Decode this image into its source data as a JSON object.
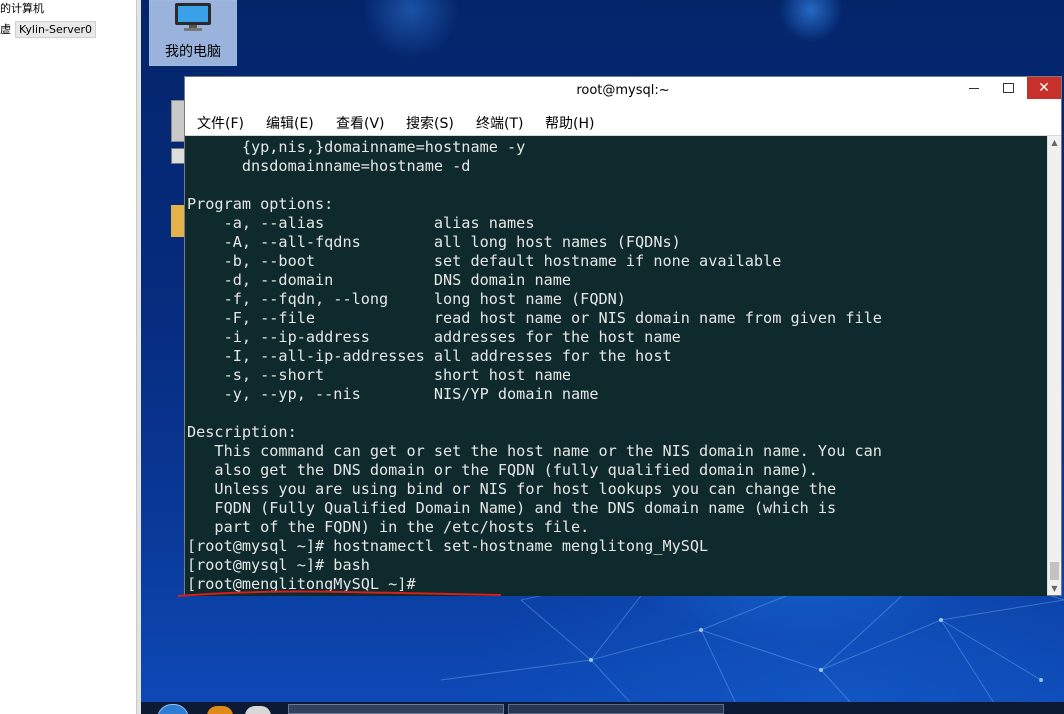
{
  "host_panel": {
    "tree_item_1": "的计算机",
    "tree_prefix": "虚",
    "tree_selected": "Kylin-Server0"
  },
  "desktop": {
    "icon_label": "我的电脑"
  },
  "window": {
    "title": "root@mysql:~",
    "buttons": {
      "minimize_icon": "minimize-icon",
      "maximize_icon": "maximize-icon",
      "close_icon": "close-icon",
      "close_glyph": "✕"
    }
  },
  "menu": [
    {
      "label": "文件(F)"
    },
    {
      "label": "编辑(E)"
    },
    {
      "label": "查看(V)"
    },
    {
      "label": "搜索(S)"
    },
    {
      "label": "终端(T)"
    },
    {
      "label": "帮助(H)"
    }
  ],
  "terminal": {
    "lines": [
      "      {yp,nis,}domainname=hostname -y",
      "      dnsdomainname=hostname -d",
      "",
      "Program options:",
      "    -a, --alias            alias names",
      "    -A, --all-fqdns        all long host names (FQDNs)",
      "    -b, --boot             set default hostname if none available",
      "    -d, --domain           DNS domain name",
      "    -f, --fqdn, --long     long host name (FQDN)",
      "    -F, --file             read host name or NIS domain name from given file",
      "    -i, --ip-address       addresses for the host name",
      "    -I, --all-ip-addresses all addresses for the host",
      "    -s, --short            short host name",
      "    -y, --yp, --nis        NIS/YP domain name",
      "",
      "Description:",
      "   This command can get or set the host name or the NIS domain name. You can",
      "   also get the DNS domain or the FQDN (fully qualified domain name).",
      "   Unless you are using bind or NIS for host lookups you can change the",
      "   FQDN (Fully Qualified Domain Name) and the DNS domain name (which is",
      "   part of the FQDN) in the /etc/hosts file.",
      "[root@mysql ~]# hostnamectl set-hostname menglitong_MySQL",
      "[root@mysql ~]# bash",
      "[root@menglitongMySQL ~]#"
    ]
  },
  "colors": {
    "terminal_bg": "#0f2a2c",
    "terminal_fg": "#e6e6e6",
    "close_button": "#c7302b",
    "annotation_red": "#d42020"
  }
}
